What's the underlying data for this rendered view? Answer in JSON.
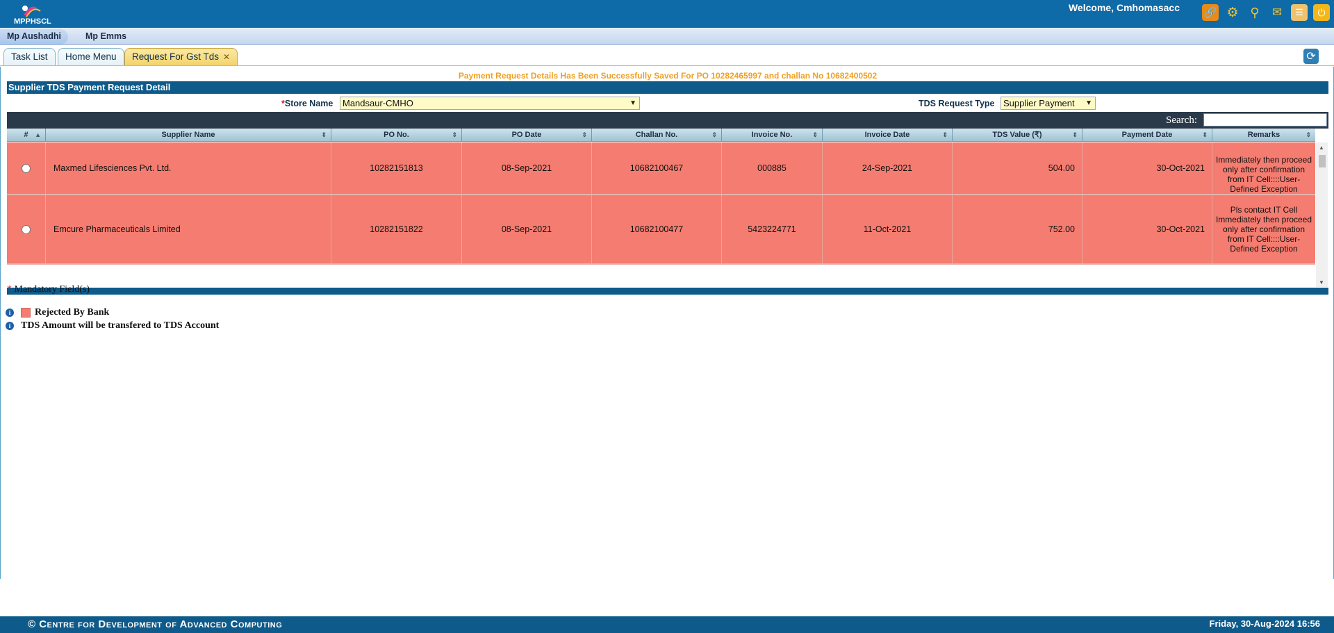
{
  "header": {
    "logo_text": "MPPHSCL",
    "welcome": "Welcome, Cmhomasacc",
    "icons": [
      "link-icon",
      "gear-icon",
      "search-icon",
      "bell-icon",
      "document-icon",
      "power-icon"
    ]
  },
  "modules": [
    {
      "label": "Mp Aushadhi",
      "active": true
    },
    {
      "label": "Mp Emms",
      "active": false
    }
  ],
  "tabs": [
    {
      "label": "Task List"
    },
    {
      "label": "Home Menu"
    },
    {
      "label": "Request For Gst Tds",
      "active": true
    }
  ],
  "success_message": "Payment Request Details Has Been Successfully Saved For PO 10282465997 and challan No 10682400502",
  "panel": {
    "title": "Supplier TDS Payment Request Detail",
    "store_label": "Store Name",
    "store_value": "Mandsaur-CMHO",
    "tds_label": "TDS Request Type",
    "tds_value": "Supplier Payment",
    "search_label": "Search:"
  },
  "table": {
    "headers": [
      "#",
      "Supplier Name",
      "PO No.",
      "PO Date",
      "Challan No.",
      "Invoice No.",
      "Invoice Date",
      "TDS Value (₹)",
      "Payment Date",
      "Remarks"
    ],
    "rows": [
      {
        "supplier": "Maxmed Lifesciences Pvt. Ltd.",
        "po_no": "10282151813",
        "po_date": "08-Sep-2021",
        "challan_no": "10682100467",
        "invoice_no": "000885",
        "invoice_date": "24-Sep-2021",
        "tds_value": "504.00",
        "payment_date": "30-Oct-2021",
        "remarks": "Immediately then proceed only after confirmation from IT Cell::::User-Defined Exception"
      },
      {
        "supplier": "Emcure Pharmaceuticals Limited",
        "po_no": "10282151822",
        "po_date": "08-Sep-2021",
        "challan_no": "10682100477",
        "invoice_no": "5423224771",
        "invoice_date": "11-Oct-2021",
        "tds_value": "752.00",
        "payment_date": "30-Oct-2021",
        "remarks": "Pls contact IT Cell Immediately then proceed only after confirmation from IT Cell::::User-Defined Exception"
      }
    ]
  },
  "notes": {
    "mandatory": "Mandatory Field(s)",
    "legend_rejected": "Rejected By Bank",
    "legend_tds": "TDS Amount will be transfered to TDS Account"
  },
  "footer": {
    "copyright": "© Centre for Development of Advanced Computing",
    "datetime": "Friday, 30-Aug-2024 16:56"
  },
  "colors": {
    "header_bg": "#0e6ba8",
    "rejected_row": "#f47c70",
    "success_text": "#f0a020"
  }
}
